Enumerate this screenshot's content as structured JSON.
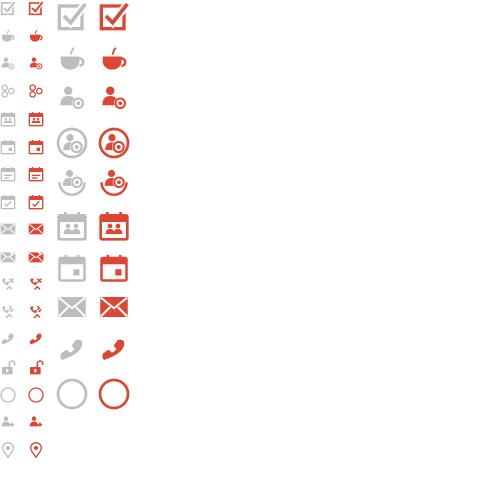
{
  "colors": {
    "gray": "#BDBDBD",
    "red": "#DC4632"
  },
  "variants": [
    "gray",
    "red"
  ],
  "small_icons": [
    "checkbox-checked-icon",
    "coffee-cup-icon",
    "user-add-icon",
    "share-nodes-icon",
    "contact-calendar-icon",
    "calendar-icon",
    "calendar-list-icon",
    "calendar-check-icon",
    "envelope-icon",
    "envelope-open-icon",
    "phone-link-icon",
    "phone-link-broken-icon",
    "phone-icon",
    "padlock-open-icon",
    "circle-outline-icon",
    "user-edit-icon",
    "map-pin-icon"
  ],
  "large_icons": [
    "checkbox-checked-icon",
    "coffee-cup-icon",
    "user-add-icon",
    "user-add-circle-icon",
    "user-add-cradle-icon",
    "contact-calendar-icon",
    "calendar-icon",
    "envelope-icon",
    "phone-icon",
    "circle-outline-icon"
  ]
}
